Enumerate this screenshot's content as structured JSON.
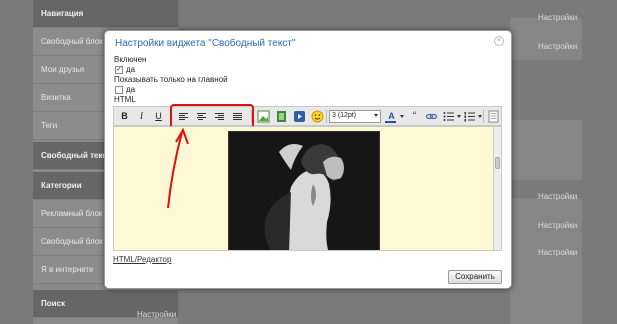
{
  "background": {
    "sidebar_items": [
      "Навигация",
      "Свободный блок",
      "Мои друзья",
      "Визитка",
      "Теги",
      "Свободный текст",
      "Категории",
      "Рекламный блок",
      "Свободный блок",
      "Я в интернете",
      "Поиск"
    ],
    "settings_label": "Настройки"
  },
  "modal": {
    "title": "Настройки виджета \"Свободный текст\"",
    "close_symbol": "×",
    "enabled_label": "Включен",
    "yes_label": "да",
    "home_only_label": "Показывать только на главной",
    "html_label": "HTML",
    "toolbar": {
      "bold": "B",
      "italic": "I",
      "underline": "U",
      "font_size": "3 (12pt)",
      "font_color": "A",
      "quote": "“"
    },
    "editor_link": "HTML/Редактор",
    "save_label": "Сохранить",
    "colors": {
      "title": "#2b6ab8",
      "editor_bg": "#fff8d4",
      "annotation": "#d11111"
    }
  }
}
